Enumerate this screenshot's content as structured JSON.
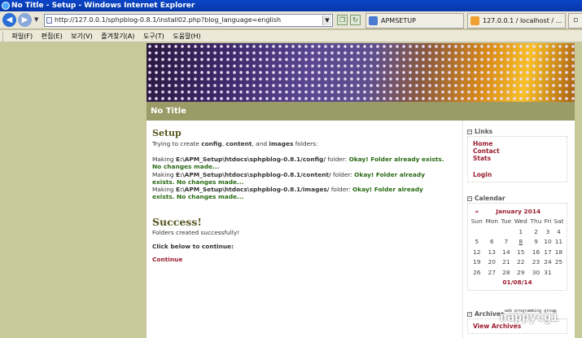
{
  "window": {
    "title": "No Title - Setup - Windows Internet Explorer"
  },
  "browser": {
    "url": "http://127.0.0.1/sphpblog-0.8.1/install02.php?blog_language=english",
    "tabs": [
      {
        "label": "APMSETUP"
      },
      {
        "label": "127.0.0.1 / localhost / ..."
      }
    ]
  },
  "menu": {
    "items": [
      "파일(F)",
      "편집(E)",
      "보기(V)",
      "즐겨찾기(A)",
      "도구(T)",
      "도움말(H)"
    ]
  },
  "page": {
    "blog_title": "No Title"
  },
  "setup": {
    "heading": "Setup",
    "intro": {
      "pre": "Trying to create ",
      "config": "config",
      "sep1": ", ",
      "content": "content",
      "sep2": ", and ",
      "images": "images",
      "post": " folders:"
    },
    "folders": [
      {
        "pre": "Making ",
        "path": "E:\\APM_Setup\\htdocs\\sphpblog-0.8.1/config/",
        "mid": " folder: ",
        "status": "Okay! Folder already exists. No changes made..."
      },
      {
        "pre": "Making ",
        "path": "E:\\APM_Setup\\htdocs\\sphpblog-0.8.1/content/",
        "mid": " folder: ",
        "status": "Okay! Folder already exists. No changes made..."
      },
      {
        "pre": "Making ",
        "path": "E:\\APM_Setup\\htdocs\\sphpblog-0.8.1/images/",
        "mid": " folder: ",
        "status": "Okay! Folder already exists. No changes made..."
      }
    ],
    "success_heading": "Success!",
    "success_text": "Folders created successfully!",
    "cta": "Click below to continue:",
    "continue_link": "Continue"
  },
  "sidebar": {
    "links": {
      "title": "Links",
      "items": [
        "Home",
        "Contact",
        "Stats"
      ],
      "login": "Login"
    },
    "calendar": {
      "title": "Calendar",
      "prev": "«",
      "month": "January 2014",
      "weekdays": [
        "Sun",
        "Mon",
        "Tue",
        "Wed",
        "Thu",
        "Fri",
        "Sat"
      ],
      "weeks": [
        [
          "",
          "",
          "",
          "1",
          "2",
          "3",
          "4"
        ],
        [
          "5",
          "6",
          "7",
          "8",
          "9",
          "10",
          "11"
        ],
        [
          "12",
          "13",
          "14",
          "15",
          "16",
          "17",
          "18"
        ],
        [
          "19",
          "20",
          "21",
          "22",
          "23",
          "24",
          "25"
        ],
        [
          "26",
          "27",
          "28",
          "29",
          "30",
          "31",
          ""
        ]
      ],
      "today": "8",
      "date": "01/08/14"
    },
    "archives": {
      "title": "Archives",
      "view": "View Archives"
    }
  },
  "watermark": {
    "text": "nappycgi",
    "sub": "web programming group"
  }
}
